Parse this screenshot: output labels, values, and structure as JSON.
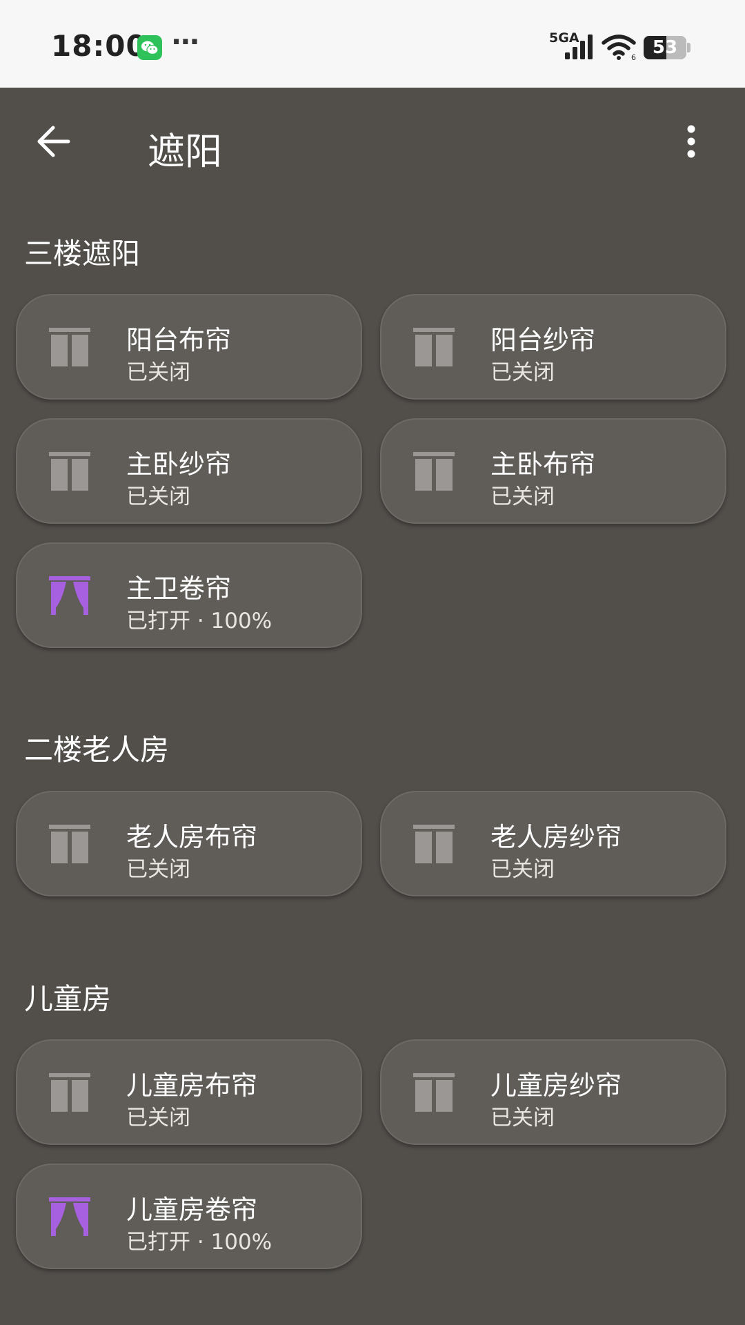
{
  "status_bar": {
    "time": "18:00",
    "network": "5GA",
    "battery_level": "53",
    "battery_fraction": 0.53,
    "icons": [
      "wechat-icon",
      "more-dots-icon",
      "signal-icon",
      "wifi-icon",
      "battery-icon"
    ]
  },
  "app_bar": {
    "title": "遮阳",
    "icons": [
      "back-arrow-icon",
      "more-vert-icon"
    ]
  },
  "colors": {
    "background": "#524f4b",
    "card": "#605d59",
    "icon_closed": "#9a9794",
    "icon_open": "#a660e0"
  },
  "sections": [
    {
      "title": "三楼遮阳",
      "cards": [
        {
          "name": "阳台布帘",
          "state": "已关闭",
          "icon": "curtain-closed-icon"
        },
        {
          "name": "阳台纱帘",
          "state": "已关闭",
          "icon": "curtain-closed-icon"
        },
        {
          "name": "主卧纱帘",
          "state": "已关闭",
          "icon": "curtain-closed-icon"
        },
        {
          "name": "主卧布帘",
          "state": "已关闭",
          "icon": "curtain-closed-icon"
        },
        {
          "name": "主卫卷帘",
          "state": "已打开 · 100%",
          "icon": "curtain-open-icon"
        }
      ]
    },
    {
      "title": "二楼老人房",
      "cards": [
        {
          "name": "老人房布帘",
          "state": "已关闭",
          "icon": "curtain-closed-icon"
        },
        {
          "name": "老人房纱帘",
          "state": "已关闭",
          "icon": "curtain-closed-icon"
        }
      ]
    },
    {
      "title": "儿童房",
      "cards": [
        {
          "name": "儿童房布帘",
          "state": "已关闭",
          "icon": "curtain-closed-icon"
        },
        {
          "name": "儿童房纱帘",
          "state": "已关闭",
          "icon": "curtain-closed-icon"
        },
        {
          "name": "儿童房卷帘",
          "state": "已打开 · 100%",
          "icon": "curtain-open-icon"
        }
      ]
    }
  ]
}
